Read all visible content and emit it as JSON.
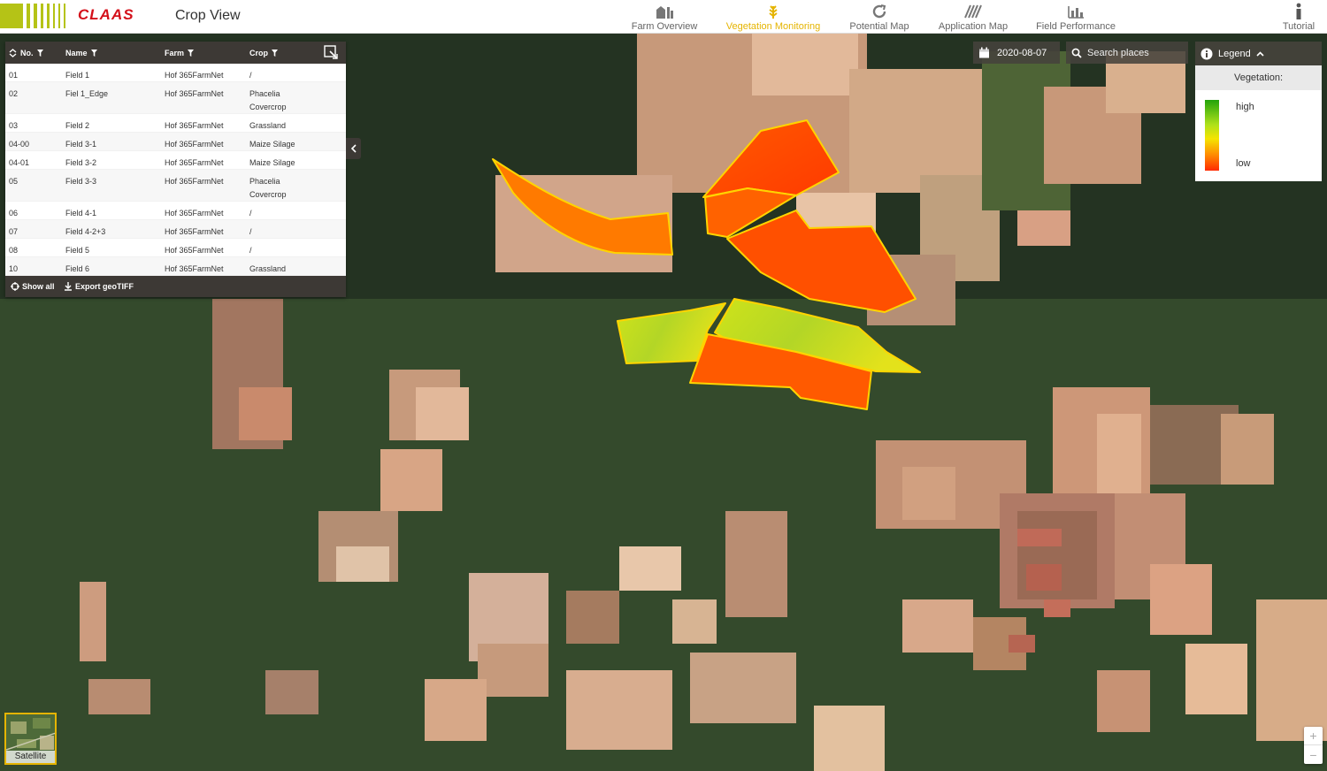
{
  "header": {
    "brand": "CLAAS",
    "title": "Crop View",
    "nav": [
      {
        "label": "Farm Overview",
        "icon": "farm-icon",
        "active": false
      },
      {
        "label": "Vegetation Monitoring",
        "icon": "wheat-icon",
        "active": true
      },
      {
        "label": "Potential Map",
        "icon": "refresh-icon",
        "active": false
      },
      {
        "label": "Application Map",
        "icon": "stripes-icon",
        "active": false
      },
      {
        "label": "Field Performance",
        "icon": "bar-chart-icon",
        "active": false
      }
    ],
    "tutorial_label": "Tutorial"
  },
  "field_table": {
    "columns": {
      "no": "No.",
      "name": "Name",
      "farm": "Farm",
      "crop": "Crop"
    },
    "rows": [
      {
        "no": "01",
        "name": "Field 1",
        "farm": "Hof 365FarmNet",
        "crop": "/"
      },
      {
        "no": "02",
        "name": "Fiel 1_Edge",
        "farm": "Hof 365FarmNet",
        "crop": "Phacelia Covercrop"
      },
      {
        "no": "03",
        "name": "Field 2",
        "farm": "Hof 365FarmNet",
        "crop": "Grassland"
      },
      {
        "no": "04-00",
        "name": "Field 3-1",
        "farm": "Hof 365FarmNet",
        "crop": "Maize Silage"
      },
      {
        "no": "04-01",
        "name": "Field 3-2",
        "farm": "Hof 365FarmNet",
        "crop": "Maize Silage"
      },
      {
        "no": "05",
        "name": "Field 3-3",
        "farm": "Hof 365FarmNet",
        "crop": "Phacelia Covercrop"
      },
      {
        "no": "06",
        "name": "Field 4-1",
        "farm": "Hof 365FarmNet",
        "crop": "/"
      },
      {
        "no": "07",
        "name": "Field 4-2+3",
        "farm": "Hof 365FarmNet",
        "crop": "/"
      },
      {
        "no": "08",
        "name": "Field 5",
        "farm": "Hof 365FarmNet",
        "crop": "/"
      },
      {
        "no": "10",
        "name": "Field 6",
        "farm": "Hof 365FarmNet",
        "crop": "Grassland"
      }
    ],
    "footer": {
      "show_all": "Show all",
      "export": "Export geoTIFF"
    }
  },
  "map_controls": {
    "date": "2020-08-07",
    "search_placeholder": "Search places",
    "legend": {
      "title": "Legend",
      "subtitle": "Vegetation:",
      "high": "high",
      "low": "low"
    },
    "layer_label": "Satellite",
    "zoom_in": "+",
    "zoom_out": "−"
  },
  "colors": {
    "accent": "#e5b400",
    "brand_red": "#d4101a",
    "brand_green": "#b5c316",
    "panel_dark": "#3d3935",
    "veg_low": "#ff3300",
    "veg_mid": "#ff8c00",
    "veg_high": "#b8e01a"
  }
}
